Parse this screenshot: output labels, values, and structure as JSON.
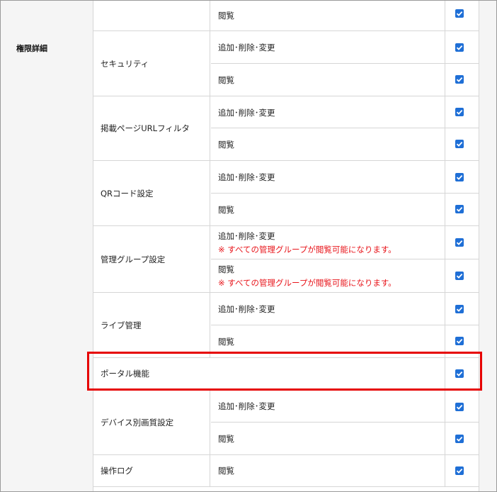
{
  "section_label": "権限詳細",
  "top_row": {
    "sub_label": "閲覧",
    "checked": true
  },
  "groups": [
    {
      "category": "セキュリティ",
      "rows": [
        {
          "label": "追加･削除･変更",
          "checked": true
        },
        {
          "label": "閲覧",
          "checked": true
        }
      ]
    },
    {
      "category": "掲載ページURLフィルタ",
      "rows": [
        {
          "label": "追加･削除･変更",
          "checked": true
        },
        {
          "label": "閲覧",
          "checked": true
        }
      ]
    },
    {
      "category": "QRコード設定",
      "rows": [
        {
          "label": "追加･削除･変更",
          "checked": true
        },
        {
          "label": "閲覧",
          "checked": true
        }
      ]
    },
    {
      "category": "管理グループ設定",
      "rows": [
        {
          "label": "追加･削除･変更",
          "note": "※ すべての管理グループが閲覧可能になります。",
          "checked": true
        },
        {
          "label": "閲覧",
          "note": "※ すべての管理グループが閲覧可能になります。",
          "checked": true
        }
      ]
    },
    {
      "category": "ライブ管理",
      "rows": [
        {
          "label": "追加･削除･変更",
          "checked": true
        },
        {
          "label": "閲覧",
          "checked": true
        }
      ]
    },
    {
      "category": "ポータル機能",
      "checked": true,
      "highlighted": true
    },
    {
      "category": "デバイス別画質設定",
      "rows": [
        {
          "label": "追加･削除･変更",
          "checked": true
        },
        {
          "label": "閲覧",
          "checked": true
        }
      ]
    },
    {
      "category": "操作ログ",
      "rows": [
        {
          "label": "閲覧",
          "checked": true
        }
      ]
    }
  ],
  "colors": {
    "checkbox": "#1f6fd6",
    "note": "#e8151b",
    "highlight": "#e60000"
  }
}
